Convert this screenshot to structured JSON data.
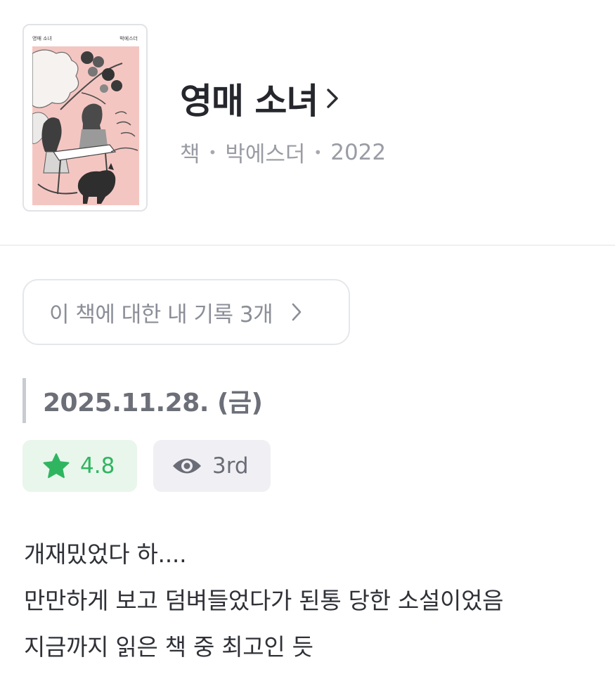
{
  "book": {
    "cover_title_left": "영매 소녀",
    "cover_title_right": "박에스더",
    "title": "영매 소녀",
    "type": "책",
    "author": "박에스더",
    "year": "2022",
    "separator": "•"
  },
  "records": {
    "label": "이 책에 대한 내 기록 3개"
  },
  "entry": {
    "date": "2025.11.28. (금)",
    "rating": "4.8",
    "read_count": "3rd",
    "review_lines": [
      "개재밌었다 하....",
      "만만하게 보고 덤벼들었다가 된통 당한 소설이었음",
      "지금까지 읽은 책 중 최고인 듯"
    ]
  },
  "colors": {
    "accent_green": "#2fb560",
    "rating_bg": "#e8f6ec",
    "cover_pink": "#f4c6c2"
  },
  "icons": {
    "title_chevron": "chevron-right-icon",
    "records_chevron": "chevron-right-icon",
    "rating": "star-icon",
    "views": "eye-icon"
  }
}
